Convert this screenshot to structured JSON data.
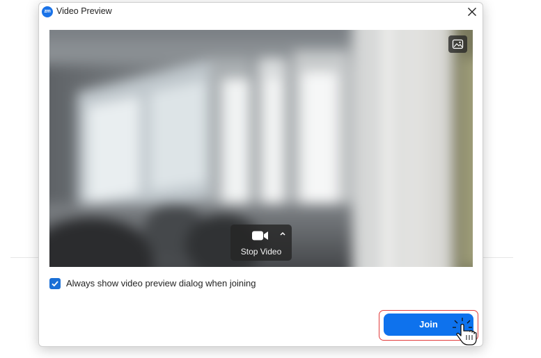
{
  "window": {
    "title": "Video Preview",
    "app_logo_text": "zm",
    "close_icon": "close-icon"
  },
  "video_preview": {
    "background_toggle_icon": "image-icon",
    "stop_video": {
      "label": "Stop Video",
      "icon": "video-camera-icon",
      "menu_icon": "caret-up-icon"
    }
  },
  "options": {
    "always_show_preview": {
      "label": "Always show video preview dialog when joining",
      "checked": true
    }
  },
  "actions": {
    "join_label": "Join"
  },
  "colors": {
    "accent": "#0e72ed",
    "checkbox": "#1a6fd6",
    "highlight": "#e23a3a"
  }
}
